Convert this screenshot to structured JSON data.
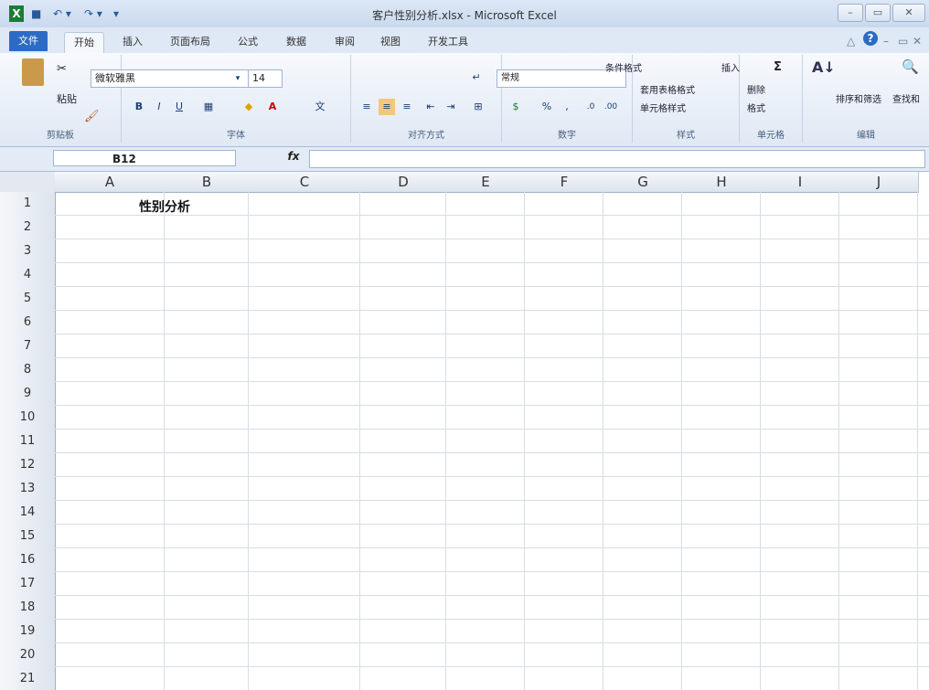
{
  "window": {
    "title": "客户性别分析.xlsx - Microsoft Excel",
    "controls": {
      "minimize": "–",
      "restore": "▭",
      "close": "✕"
    }
  },
  "quick_access": {
    "app_icon": "X",
    "save": "■",
    "undo": "↶ ▾",
    "redo": "↷ ▾",
    "customize": "▾"
  },
  "tabs": [
    "文件",
    "开始",
    "插入",
    "页面布局",
    "公式",
    "数据",
    "审阅",
    "视图",
    "开发工具"
  ],
  "active_tab": "开始",
  "ribbon_right": {
    "help": "?",
    "minimize": "–",
    "restore": "▭",
    "close": "✕"
  },
  "ribbon": {
    "clipboard": {
      "paste": "粘贴",
      "label": "剪贴板"
    },
    "font": {
      "name": "微软雅黑",
      "size": "14",
      "bold": "B",
      "italic": "I",
      "underline": "U",
      "label": "字体"
    },
    "alignment": {
      "label": "对齐方式"
    },
    "number": {
      "format": "常规",
      "percent": "%",
      "comma": ",",
      "label": "数字"
    },
    "styles": {
      "conditional": "条件格式",
      "table_format": "套用表格格式",
      "cell_styles": "单元格样式",
      "label": "样式"
    },
    "cells": {
      "insert": "插入",
      "delete": "删除",
      "format": "格式",
      "label": "单元格"
    },
    "editing": {
      "sum": "Σ",
      "sort_filter": "排序和筛选",
      "find_select": "查找和",
      "label": "编辑"
    }
  },
  "formula_bar": {
    "name_box": "B12",
    "fx": "fx",
    "value": ""
  },
  "grid": {
    "columns": [
      "A",
      "B",
      "C",
      "D",
      "E",
      "F",
      "G",
      "H",
      "I",
      "J"
    ],
    "rows": [
      "1",
      "2",
      "3",
      "4",
      "5",
      "6",
      "7",
      "8",
      "9",
      "10",
      "11",
      "12",
      "13",
      "14",
      "15",
      "16",
      "17",
      "18",
      "19",
      "20",
      "21"
    ],
    "cell_a1": "性别分析"
  },
  "colors": {
    "accent": "#2b6bc4",
    "ribbon_bg": "#dfe8f4",
    "grid_line": "#d6dde7"
  }
}
